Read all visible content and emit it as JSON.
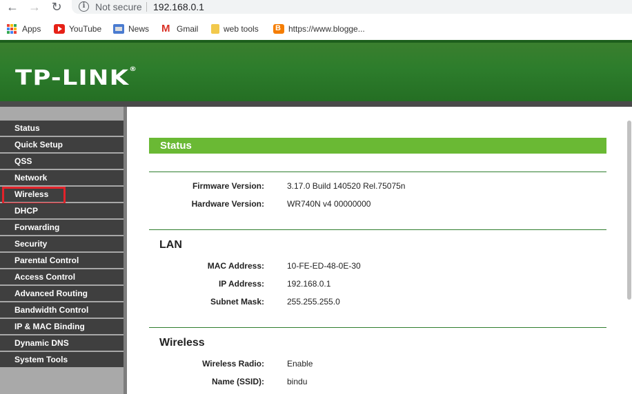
{
  "browser": {
    "not_secure_label": "Not secure",
    "url": "192.168.0.1",
    "bookmarks": [
      {
        "label": "Apps",
        "icon": "apps-grid-icon"
      },
      {
        "label": "YouTube",
        "icon": "youtube-icon"
      },
      {
        "label": "News",
        "icon": "news-icon"
      },
      {
        "label": "Gmail",
        "icon": "gmail-icon"
      },
      {
        "label": "web tools",
        "icon": "folder-icon"
      },
      {
        "label": "https://www.blogge...",
        "icon": "blogger-icon"
      }
    ]
  },
  "header": {
    "brand": "TP-LINK",
    "brand_mark": "®",
    "color": "#2d7d2c"
  },
  "sidebar": {
    "items": [
      {
        "label": "Status"
      },
      {
        "label": "Quick Setup"
      },
      {
        "label": "QSS"
      },
      {
        "label": "Network"
      },
      {
        "label": "Wireless",
        "highlighted": true
      },
      {
        "label": "DHCP"
      },
      {
        "label": "Forwarding"
      },
      {
        "label": "Security"
      },
      {
        "label": "Parental Control"
      },
      {
        "label": "Access Control"
      },
      {
        "label": "Advanced Routing"
      },
      {
        "label": "Bandwidth Control"
      },
      {
        "label": "IP & MAC Binding"
      },
      {
        "label": "Dynamic DNS"
      },
      {
        "label": "System Tools"
      }
    ],
    "highlight_color": "#e4222a"
  },
  "main": {
    "page_title": "Status",
    "accent_color": "#6ab934",
    "general": [
      {
        "label": "Firmware Version:",
        "value": "3.17.0 Build 140520 Rel.75075n"
      },
      {
        "label": "Hardware Version:",
        "value": "WR740N v4 00000000"
      }
    ],
    "lan": {
      "title": "LAN",
      "rows": [
        {
          "label": "MAC Address:",
          "value": "10-FE-ED-48-0E-30"
        },
        {
          "label": "IP Address:",
          "value": "192.168.0.1"
        },
        {
          "label": "Subnet Mask:",
          "value": "255.255.255.0"
        }
      ]
    },
    "wireless": {
      "title": "Wireless",
      "rows": [
        {
          "label": "Wireless Radio:",
          "value": "Enable"
        },
        {
          "label": "Name (SSID):",
          "value": "bindu"
        }
      ]
    }
  }
}
